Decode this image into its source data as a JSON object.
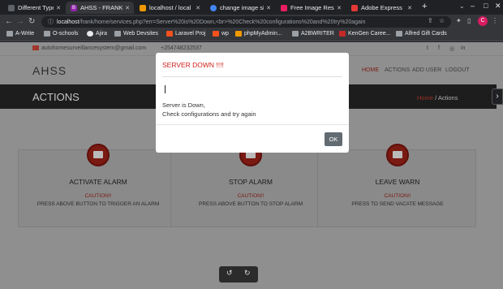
{
  "tabs": [
    {
      "label": "Different Types",
      "active": false,
      "color": "#5f6368"
    },
    {
      "label": "AHSS - FRANK",
      "active": true,
      "color": "#8e24aa",
      "fav": "B"
    },
    {
      "label": "localhost / local",
      "active": false,
      "color": "#f29900"
    },
    {
      "label": "change image si",
      "active": false,
      "color": "#4285f4"
    },
    {
      "label": "Free Image Resiz",
      "active": false,
      "color": "#e91e63"
    },
    {
      "label": "Adobe Express",
      "active": false,
      "color": "#e53935"
    }
  ],
  "new_tab": "+",
  "tab_menu": "⌄",
  "window_controls": {
    "minimize": "–",
    "maximize": "□",
    "close": "✕"
  },
  "toolbar": {
    "back": "←",
    "forward": "→",
    "reload": "↻"
  },
  "address": {
    "host": "localhost",
    "path": "/frank/home/services.php?err=Server%20is%20Down,<br>%20Check%20configurations%20and%20try%20again"
  },
  "bookmarks": [
    {
      "label": "A-Write",
      "type": "folder"
    },
    {
      "label": "O-schools",
      "type": "folder"
    },
    {
      "label": "Ajira",
      "type": "site",
      "color": "#e8eaed"
    },
    {
      "label": "Web Devsites",
      "type": "folder"
    },
    {
      "label": "Laravel Proj",
      "type": "site",
      "color": "#f4511e"
    },
    {
      "label": "wp",
      "type": "site",
      "color": "#f4511e"
    },
    {
      "label": "phpMyAdmin...",
      "type": "site",
      "color": "#f29900"
    },
    {
      "label": "A2BWRITER",
      "type": "folder"
    },
    {
      "label": "KenGen Caree...",
      "type": "site",
      "color": "#c62828"
    },
    {
      "label": "Alfred Gift Cards",
      "type": "folder"
    }
  ],
  "site": {
    "email": "autohomesurveillancesystem@gmail.com",
    "phone": "+254748232537",
    "socials": [
      "t",
      "f",
      "◎",
      "in"
    ],
    "brand": "AHSS",
    "nav": [
      "HOME",
      "ACTIONS",
      "ADD USER",
      "LOGOUT"
    ],
    "banner_title": "ACTIONS",
    "crumb_home": "Home",
    "crumb_sep": "/",
    "crumb_current": "Actions",
    "cards": [
      {
        "title": "ACTIVATE ALARM",
        "caution": "CAUTION!!",
        "desc": "PRESS ABOVE BUTTON TO TRIGGER AN ALARM"
      },
      {
        "title": "STOP ALARM",
        "caution": "CAUTION!!",
        "desc": "PRESS ABOVE BUTTON TO STOP ALARM"
      },
      {
        "title": "LEAVE WARN",
        "caution": "CAUTION!!",
        "desc": "PRESS TO SEND VACATE MESSAGE"
      }
    ]
  },
  "modal": {
    "title": "SERVER DOWN !!!!",
    "body_line1": "Server is Down,",
    "body_line2": "Check configurations and try again",
    "ok_label": "OK"
  },
  "colors": {
    "accent": "#7a1a12",
    "error": "#d0211c"
  }
}
